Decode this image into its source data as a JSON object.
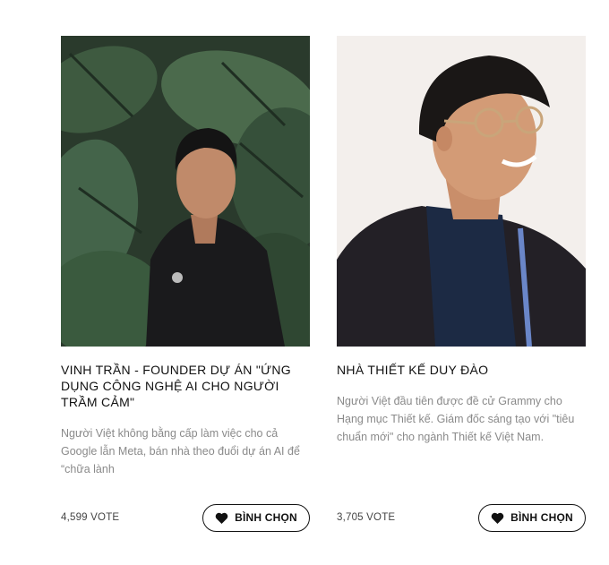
{
  "cards": [
    {
      "title": "VINH TRẦN - FOUNDER DỰ ÁN \"ỨNG DỤNG CÔNG NGHỆ AI CHO NGƯỜI TRẦM CẢM\"",
      "description": "Người Việt không bằng cấp làm việc cho cả Google lẫn Meta, bán nhà theo đuổi dự án AI để “chữa lành",
      "votes": "4,599 VOTE",
      "button_label": "BÌNH CHỌN",
      "button_icon": "heart-icon",
      "photo": "portrait of man among monstera leaves"
    },
    {
      "title": "NHÀ THIẾT KẾ DUY ĐÀO",
      "description": "Người Việt đầu tiên được đề cử Grammy cho Hạng mục Thiết kế. Giám đốc sáng tạo với \"tiêu chuẩn mới\" cho ngành Thiết kế Việt Nam.",
      "votes": "3,705 VOTE",
      "button_label": "BÌNH CHỌN",
      "button_icon": "heart-icon",
      "photo": "portrait of smiling man with glasses"
    }
  ],
  "colors": {
    "text": "#111111",
    "muted": "#8a8a8a",
    "button_border": "#111111"
  }
}
